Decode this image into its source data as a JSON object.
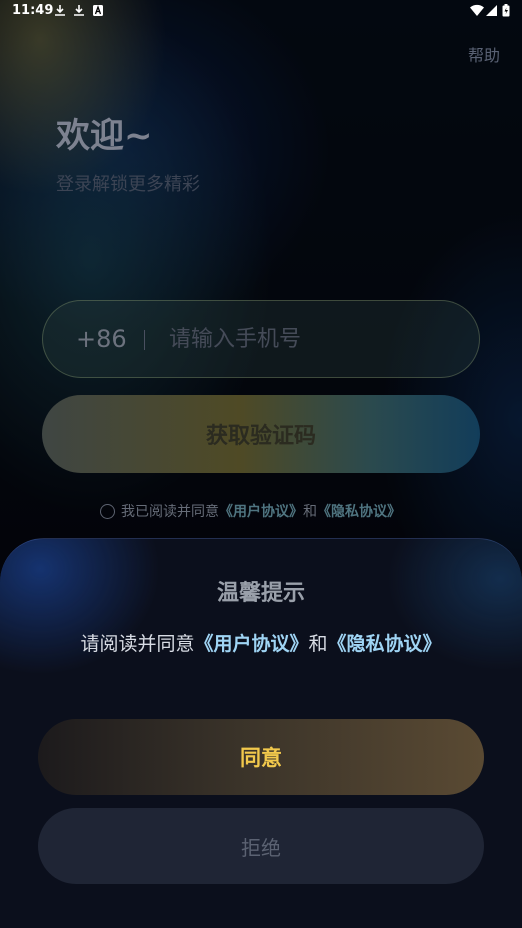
{
  "status_bar": {
    "time": "11:49",
    "left_icons": [
      "download-icon",
      "download-icon",
      "a-icon"
    ],
    "right_icons": [
      "wifi-icon",
      "signal-icon",
      "battery-icon"
    ]
  },
  "header": {
    "help": "帮助"
  },
  "welcome": {
    "title": "欢迎~",
    "subtitle": "登录解锁更多精彩"
  },
  "phone": {
    "country_code": "+86",
    "placeholder": "请输入手机号",
    "value": ""
  },
  "get_code_button": "获取验证码",
  "agreement_row": {
    "prefix": "我已阅读并同意",
    "user_agreement": "《用户协议》",
    "and": "和",
    "privacy_agreement": "《隐私协议》",
    "checked": false
  },
  "dialog": {
    "title": "温馨提示",
    "message_prefix": "请阅读并同意",
    "user_agreement": "《用户协议》",
    "and": "和",
    "privacy_agreement": "《隐私协议》",
    "agree_button": "同意",
    "reject_button": "拒绝"
  },
  "colors": {
    "accent_gold": "#f2c94c",
    "link_blue": "#9fd4f4",
    "sheet_bg": "#0b0f1c"
  }
}
